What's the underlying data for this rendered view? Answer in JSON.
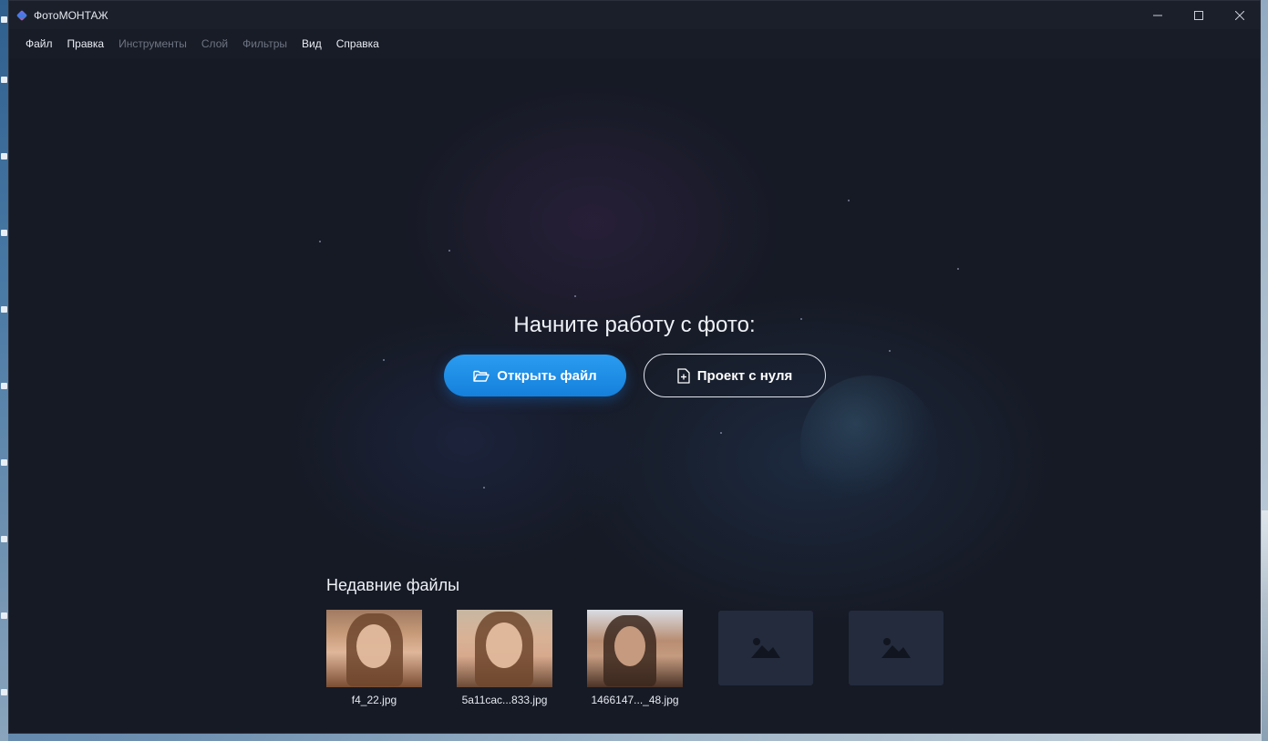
{
  "window": {
    "title": "ФотоМОНТАЖ"
  },
  "menu": [
    {
      "label": "Файл",
      "enabled": true
    },
    {
      "label": "Правка",
      "enabled": true
    },
    {
      "label": "Инструменты",
      "enabled": false
    },
    {
      "label": "Слой",
      "enabled": false
    },
    {
      "label": "Фильтры",
      "enabled": false
    },
    {
      "label": "Вид",
      "enabled": true
    },
    {
      "label": "Справка",
      "enabled": true
    }
  ],
  "start": {
    "headline": "Начните работу с фото:",
    "open_file_label": "Открыть файл",
    "new_project_label": "Проект с нуля"
  },
  "recent": {
    "title": "Недавние файлы",
    "files": [
      {
        "name": "f4_22.jpg"
      },
      {
        "name": "5a11cac...833.jpg"
      },
      {
        "name": "1466147..._48.jpg"
      }
    ]
  },
  "colors": {
    "accent": "#1b8fe8",
    "window_bg": "#161a25"
  }
}
